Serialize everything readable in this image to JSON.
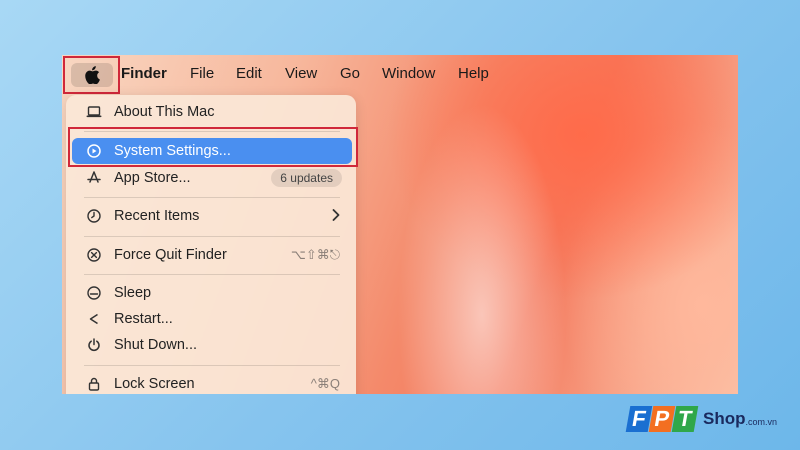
{
  "menubar": {
    "app_name": "Finder",
    "items": [
      "File",
      "Edit",
      "View",
      "Go",
      "Window",
      "Help"
    ]
  },
  "apple_menu": {
    "about": "About This Mac",
    "system_settings": "System Settings...",
    "app_store": "App Store...",
    "app_store_badge": "6 updates",
    "recent_items": "Recent Items",
    "force_quit": "Force Quit Finder",
    "force_quit_shortcut": "⌥⇧⌘⎋",
    "sleep": "Sleep",
    "restart": "Restart...",
    "shut_down": "Shut Down...",
    "lock_screen": "Lock Screen",
    "lock_screen_shortcut": "^⌘Q"
  },
  "logo": {
    "letters": [
      "F",
      "P",
      "T"
    ],
    "shop": "Shop",
    "domain": ".com.vn"
  },
  "colors": {
    "highlight": "#4a8ff0",
    "annotation": "#d0283a",
    "logo_blue": "#1a6fd1",
    "logo_orange": "#f36f21",
    "logo_green": "#30a74a"
  }
}
